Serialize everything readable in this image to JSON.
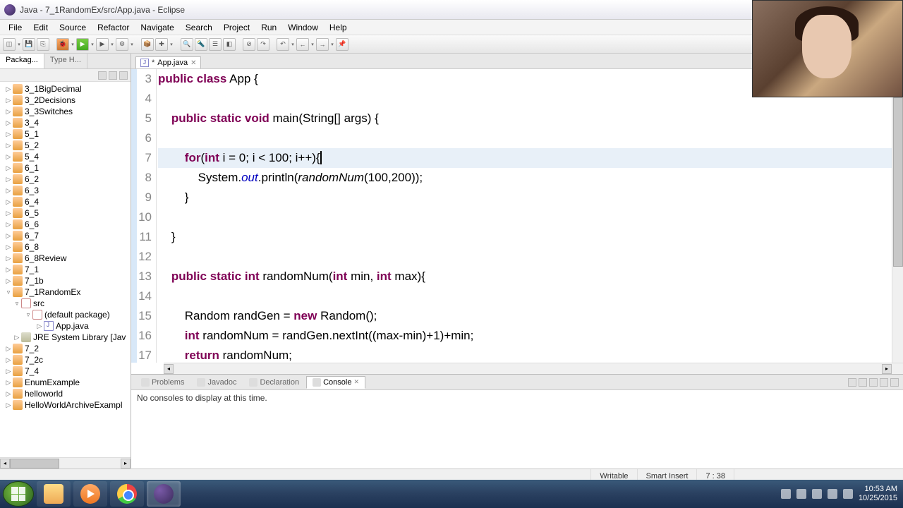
{
  "window": {
    "title": "Java - 7_1RandomEx/src/App.java - Eclipse"
  },
  "menu": [
    "File",
    "Edit",
    "Source",
    "Refactor",
    "Navigate",
    "Search",
    "Project",
    "Run",
    "Window",
    "Help"
  ],
  "pkgtabs": {
    "primary": "Packag...",
    "secondary": "Type H..."
  },
  "tree": [
    {
      "l": 0,
      "exp": "▷",
      "icon": "folder",
      "label": "3_1BigDecimal"
    },
    {
      "l": 0,
      "exp": "▷",
      "icon": "folder",
      "label": "3_2Decisions"
    },
    {
      "l": 0,
      "exp": "▷",
      "icon": "folder",
      "label": "3_3Switches"
    },
    {
      "l": 0,
      "exp": "▷",
      "icon": "folder",
      "label": "3_4"
    },
    {
      "l": 0,
      "exp": "▷",
      "icon": "folder",
      "label": "5_1"
    },
    {
      "l": 0,
      "exp": "▷",
      "icon": "folder",
      "label": "5_2"
    },
    {
      "l": 0,
      "exp": "▷",
      "icon": "folder",
      "label": "5_4"
    },
    {
      "l": 0,
      "exp": "▷",
      "icon": "folder",
      "label": "6_1"
    },
    {
      "l": 0,
      "exp": "▷",
      "icon": "folder",
      "label": "6_2"
    },
    {
      "l": 0,
      "exp": "▷",
      "icon": "folder",
      "label": "6_3"
    },
    {
      "l": 0,
      "exp": "▷",
      "icon": "folder",
      "label": "6_4"
    },
    {
      "l": 0,
      "exp": "▷",
      "icon": "folder",
      "label": "6_5"
    },
    {
      "l": 0,
      "exp": "▷",
      "icon": "folder",
      "label": "6_6"
    },
    {
      "l": 0,
      "exp": "▷",
      "icon": "folder",
      "label": "6_7"
    },
    {
      "l": 0,
      "exp": "▷",
      "icon": "folder",
      "label": "6_8"
    },
    {
      "l": 0,
      "exp": "▷",
      "icon": "folder",
      "label": "6_8Review"
    },
    {
      "l": 0,
      "exp": "▷",
      "icon": "folder",
      "label": "7_1"
    },
    {
      "l": 0,
      "exp": "▷",
      "icon": "folder",
      "label": "7_1b"
    },
    {
      "l": 0,
      "exp": "▿",
      "icon": "folder",
      "label": "7_1RandomEx"
    },
    {
      "l": 1,
      "exp": "▿",
      "icon": "pkg",
      "label": "src"
    },
    {
      "l": 2,
      "exp": "▿",
      "icon": "pkg",
      "label": "(default package)"
    },
    {
      "l": 3,
      "exp": "▷",
      "icon": "jfile",
      "label": "App.java"
    },
    {
      "l": 1,
      "exp": "▷",
      "icon": "lib",
      "label": "JRE System Library [Jav"
    },
    {
      "l": 0,
      "exp": "▷",
      "icon": "folder",
      "label": "7_2"
    },
    {
      "l": 0,
      "exp": "▷",
      "icon": "folder",
      "label": "7_2c"
    },
    {
      "l": 0,
      "exp": "▷",
      "icon": "folder",
      "label": "7_4"
    },
    {
      "l": 0,
      "exp": "▷",
      "icon": "folder",
      "label": "EnumExample"
    },
    {
      "l": 0,
      "exp": "▷",
      "icon": "folder",
      "label": "helloworld"
    },
    {
      "l": 0,
      "exp": "▷",
      "icon": "folder",
      "label": "HelloWorldArchiveExampl"
    }
  ],
  "editortab": {
    "dirty": "*",
    "name": "App.java"
  },
  "gutter": [
    "3",
    "4",
    "5",
    "6",
    "7",
    "8",
    "9",
    "10",
    "11",
    "12",
    "13",
    "14",
    "15",
    "16",
    "17"
  ],
  "code": {
    "l3": {
      "kw1": "public",
      "kw2": "class",
      "rest": " App {"
    },
    "l5": {
      "indent": "    ",
      "kw1": "public",
      "kw2": "static",
      "kw3": "void",
      "rest": " main(String[] args) {"
    },
    "l7": {
      "indent": "        ",
      "kw1": "for",
      "mid": "(",
      "kw2": "int",
      "rest": " i = 0; i < 100; i++){"
    },
    "l8": {
      "indent": "            ",
      "pre": "System.",
      "field": "out",
      "mid": ".println(",
      "meth": "randomNum",
      "rest": "(100,200));"
    },
    "l9": {
      "indent": "        ",
      "rest": "}"
    },
    "l11": {
      "indent": "    ",
      "rest": "}"
    },
    "l13": {
      "indent": "    ",
      "kw1": "public",
      "kw2": "static",
      "kw3": "int",
      "rest": " randomNum(",
      "kw4": "int",
      "mid": " min, ",
      "kw5": "int",
      "rest2": " max){"
    },
    "l15": {
      "indent": "        ",
      "pre": "Random randGen = ",
      "kw1": "new",
      "rest": " Random();"
    },
    "l16": {
      "indent": "        ",
      "kw1": "int",
      "rest": " randomNum = randGen.nextInt((max-min)+1)+min;"
    },
    "l17": {
      "indent": "        ",
      "kw1": "return",
      "rest": " randomNum;"
    }
  },
  "bottomtabs": {
    "problems": "Problems",
    "javadoc": "Javadoc",
    "declaration": "Declaration",
    "console": "Console"
  },
  "console_msg": "No consoles to display at this time.",
  "status": {
    "writable": "Writable",
    "insert": "Smart Insert",
    "pos": "7 : 38"
  },
  "clock": {
    "time": "10:53 AM",
    "date": "10/25/2015"
  }
}
